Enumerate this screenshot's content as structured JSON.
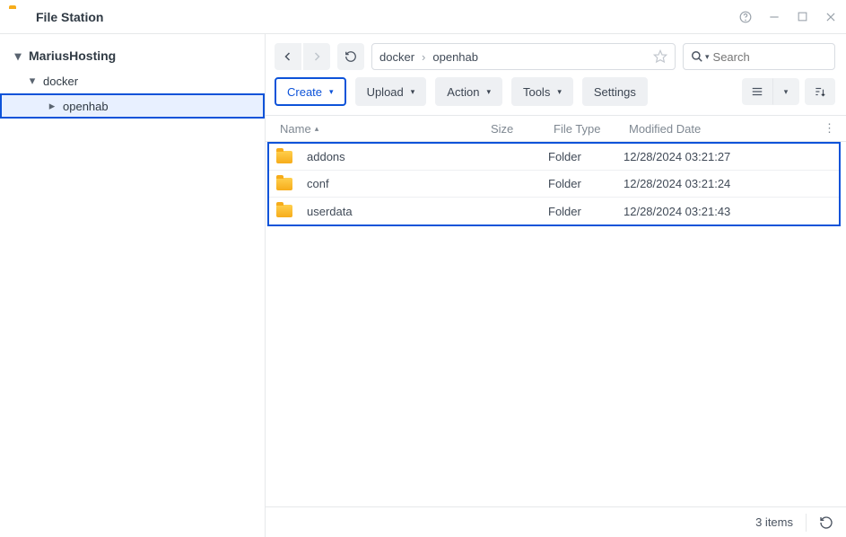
{
  "app": {
    "title": "File Station"
  },
  "sidebar": {
    "root": "MariusHosting",
    "nodes": [
      {
        "label": "docker",
        "children": [
          {
            "label": "openhab",
            "selected": true
          }
        ]
      }
    ]
  },
  "breadcrumb": {
    "segments": [
      "docker",
      "openhab"
    ]
  },
  "search": {
    "placeholder": "Search"
  },
  "toolbar": {
    "create": "Create",
    "upload": "Upload",
    "action": "Action",
    "tools": "Tools",
    "settings": "Settings"
  },
  "columns": {
    "name": "Name",
    "size": "Size",
    "type": "File Type",
    "date": "Modified Date"
  },
  "rows": [
    {
      "name": "addons",
      "size": "",
      "type": "Folder",
      "date": "12/28/2024 03:21:27"
    },
    {
      "name": "conf",
      "size": "",
      "type": "Folder",
      "date": "12/28/2024 03:21:24"
    },
    {
      "name": "userdata",
      "size": "",
      "type": "Folder",
      "date": "12/28/2024 03:21:43"
    }
  ],
  "footer": {
    "count_text": "3 items"
  }
}
